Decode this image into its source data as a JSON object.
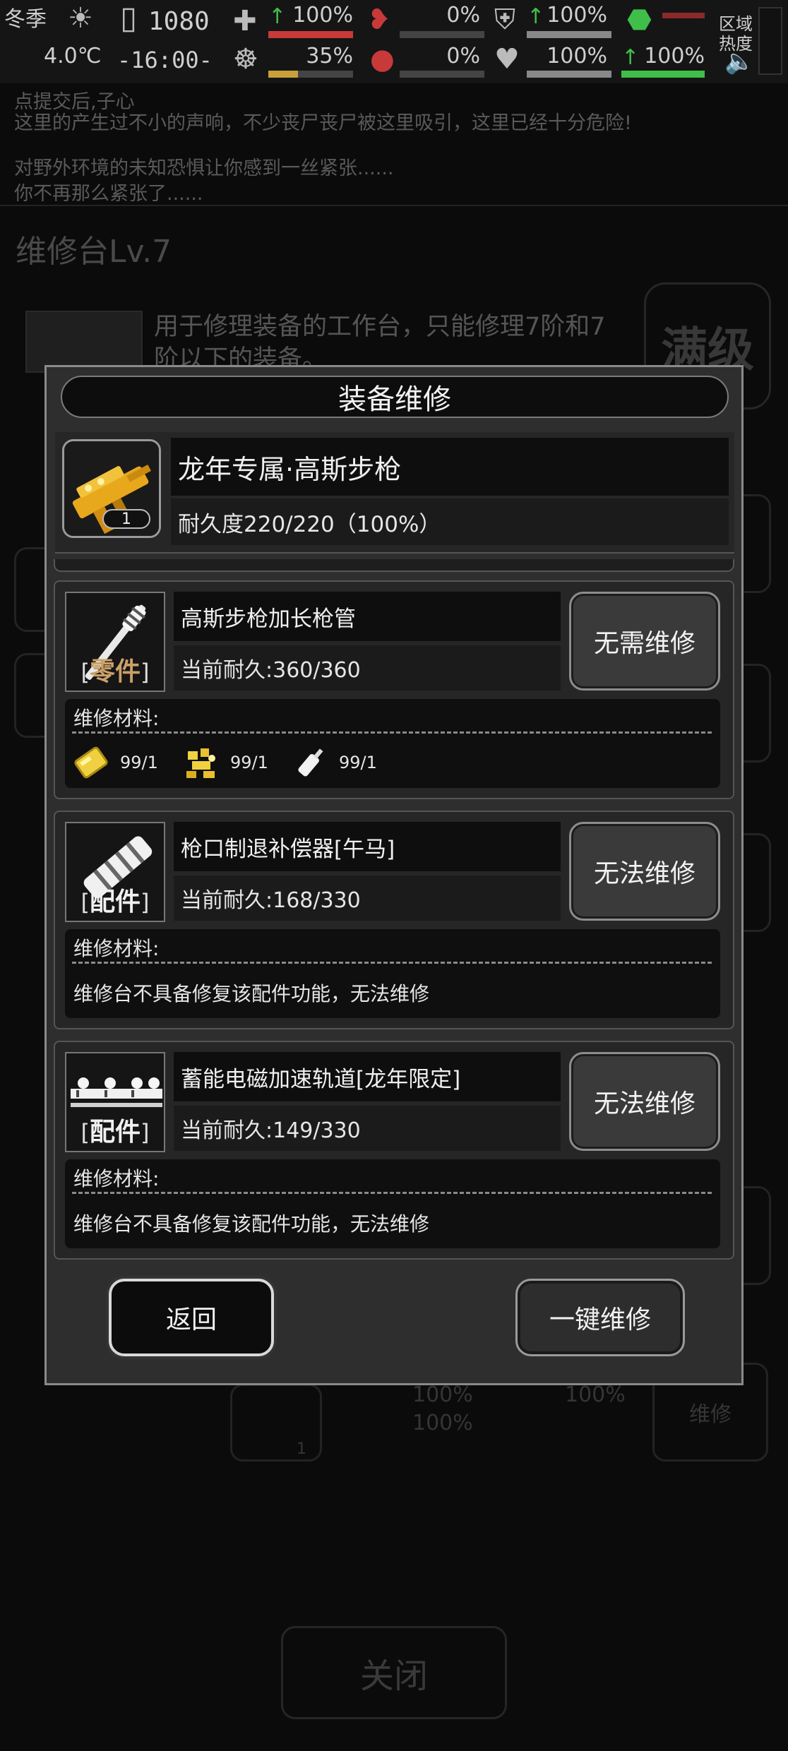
{
  "status": {
    "season": "冬季",
    "temperature": "4.0℃",
    "day": "1080",
    "time": "-16:00-",
    "health_pct": "100%",
    "hunger_pct": "35%",
    "bleed_pct": "0%",
    "blood_pct": "0%",
    "armor_pct": "100%",
    "heart_pct": "100%",
    "stamina_pct": "100%",
    "zone_label_1": "区域",
    "zone_label_2": "热度"
  },
  "background": {
    "msg_top": "点提交后,子心",
    "msg_1": "这里的产生过不小的声响，不少丧尸丧尸被这里吸引，这里已经十分危险!",
    "msg_2": "对野外环境的未知恐惧让你感到一丝紧张......",
    "msg_3": "你不再那么紧张了......",
    "panel_title": "维修台Lv.7",
    "panel_desc": "用于修理装备的工作台，只能修理7阶和7阶以下的装备。",
    "max_badge": "满级",
    "bg_pct_1": "100%",
    "bg_pct_2": "100%",
    "bg_pct_3": "100%",
    "bg_count": "1",
    "bg_repair": "维修",
    "close_label": "关闭"
  },
  "dialog": {
    "title": "装备维修",
    "equipment": {
      "name": "龙年专属·高斯步枪",
      "durability": "耐久度220/220（100%）",
      "count": "1"
    },
    "parts": [
      {
        "tag_left": "[",
        "tag": "零件",
        "tag_right": "]",
        "name": "高斯步枪加长枪管",
        "durability": "当前耐久:360/360",
        "button": "无需维修",
        "materials_label": "维修材料:",
        "materials": [
          {
            "icon": "gold-bar-icon",
            "count": "99/1"
          },
          {
            "icon": "gear-scrap-icon",
            "count": "99/1"
          },
          {
            "icon": "oil-bottle-icon",
            "count": "99/1"
          }
        ]
      },
      {
        "tag_left": "[",
        "tag": "配件",
        "tag_right": "]",
        "name": "枪口制退补偿器[午马]",
        "durability": "当前耐久:168/330",
        "button": "无法维修",
        "materials_label": "维修材料:",
        "note": "维修台不具备修复该配件功能，无法维修"
      },
      {
        "tag_left": "[",
        "tag": "配件",
        "tag_right": "]",
        "name": "蓄能电磁加速轨道[龙年限定]",
        "durability": "当前耐久:149/330",
        "button": "无法维修",
        "materials_label": "维修材料:",
        "note": "维修台不具备修复该配件功能，无法维修"
      }
    ],
    "back_label": "返回",
    "repair_all_label": "一键维修"
  },
  "colors": {
    "gold_icon": "#e8a81c",
    "health_bar": "#c83a3a",
    "stamina_bar": "#3fbf4a"
  }
}
